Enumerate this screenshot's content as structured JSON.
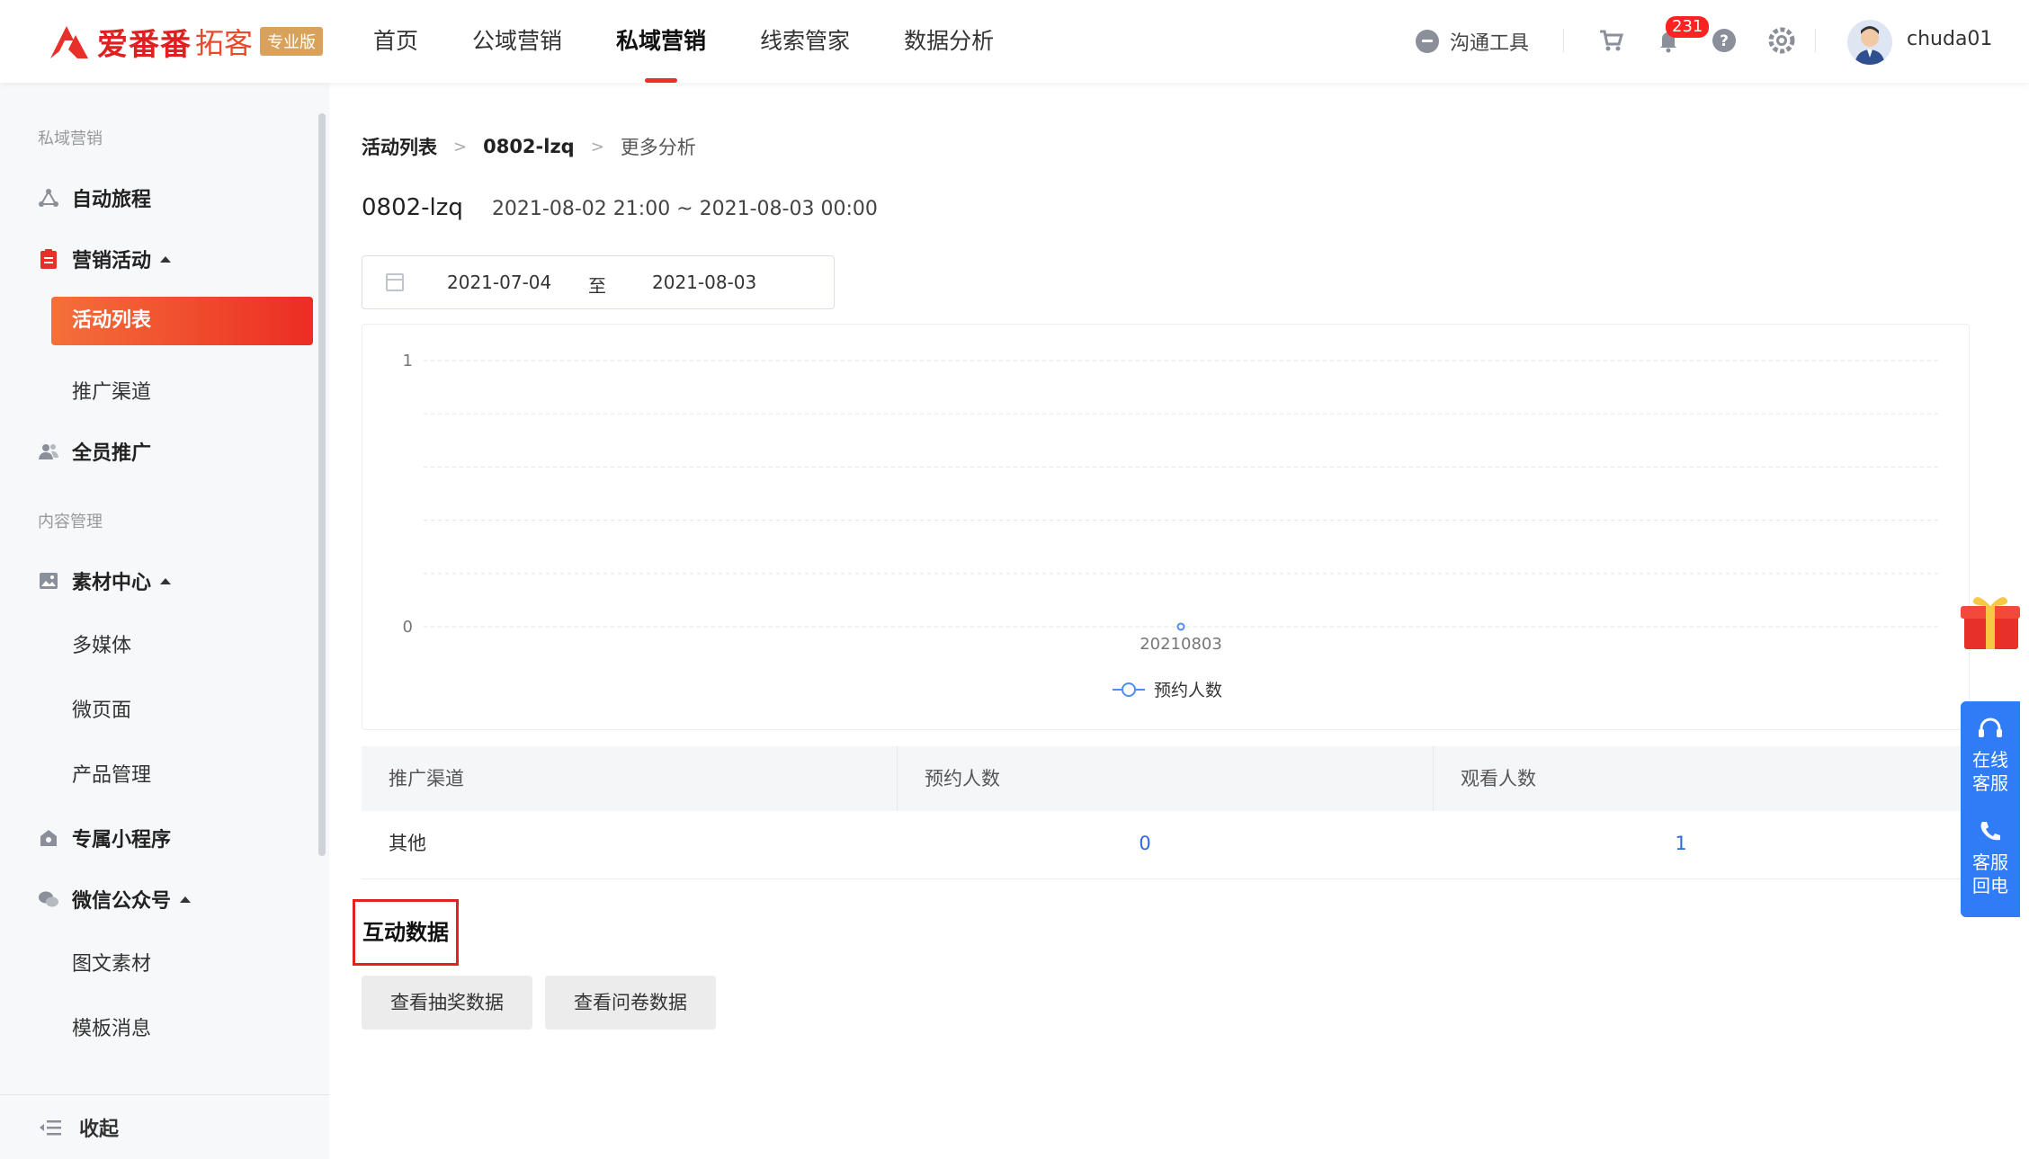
{
  "brand": {
    "name": "爱番番",
    "sub": "拓客",
    "edition": "专业版",
    "accent": "#e8302a"
  },
  "nav": {
    "items": [
      {
        "label": "首页",
        "active": false
      },
      {
        "label": "公域营销",
        "active": false
      },
      {
        "label": "私域营销",
        "active": true
      },
      {
        "label": "线索管家",
        "active": false
      },
      {
        "label": "数据分析",
        "active": false
      }
    ]
  },
  "header": {
    "comm_tool": "沟通工具",
    "notifications": "231",
    "username": "chuda01"
  },
  "sidebar": {
    "section_private": "私域营销",
    "auto_journey": "自动旅程",
    "campaigns": "营销活动",
    "campaign_list": "活动列表",
    "channels": "推广渠道",
    "all_staff": "全员推广",
    "section_content": "内容管理",
    "materials": "素材中心",
    "multimedia": "多媒体",
    "micro_page": "微页面",
    "products": "产品管理",
    "mini_program": "专属小程序",
    "wechat_oa": "微信公众号",
    "articles": "图文素材",
    "templates": "模板消息",
    "collapse": "收起"
  },
  "breadcrumb": {
    "root": "活动列表",
    "activity": "0802-lzq",
    "current": "更多分析"
  },
  "activity": {
    "title": "0802-lzq",
    "time": "2021-08-02 21:00 ~ 2021-08-03 00:00"
  },
  "date_range": {
    "start": "2021-07-04",
    "separator": "至",
    "end": "2021-08-03"
  },
  "chart_data": {
    "type": "line",
    "x": [
      "20210803"
    ],
    "series": [
      {
        "name": "预约人数",
        "values": [
          0
        ],
        "color": "#4d8ef0"
      }
    ],
    "ylim": [
      0,
      1
    ],
    "yticks": [
      0,
      1
    ],
    "grid": true,
    "legend": "bottom-center"
  },
  "table": {
    "headers": [
      "推广渠道",
      "预约人数",
      "观看人数"
    ],
    "rows": [
      {
        "channel": "其他",
        "booked": "0",
        "watched": "1"
      }
    ]
  },
  "interaction": {
    "title": "互动数据",
    "lottery_btn": "查看抽奖数据",
    "survey_btn": "查看问卷数据"
  },
  "service": {
    "online": "在线客服",
    "callback": "客服回电"
  }
}
